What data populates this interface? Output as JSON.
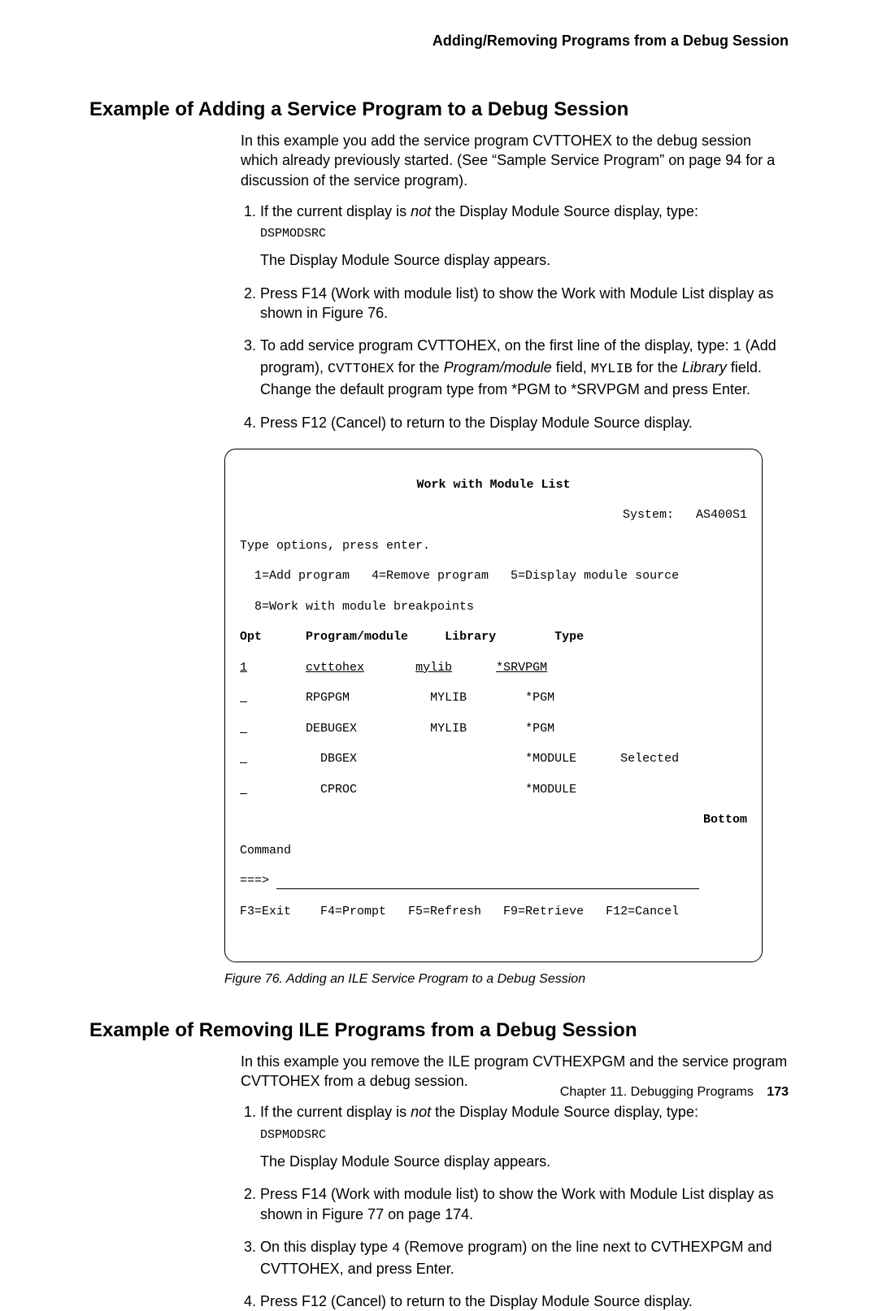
{
  "running_head": "Adding/Removing Programs from a Debug Session",
  "section1": {
    "title": "Example of Adding a Service Program to a Debug Session",
    "intro": "In this example you add the service program CVTTOHEX to the debug session which already previously started. (See “Sample Service Program” on page 94 for a discussion of the service program).",
    "step1a": "If the current display is ",
    "step1_not": "not",
    "step1b": " the Display Module Source display, type:",
    "step1_cmd": "DSPMODSRC",
    "step1_after": "The Display Module Source display appears.",
    "step2": "Press F14 (Work with module list) to show the Work with Module List display as shown in Figure 76.",
    "step3a": "To add service program CVTTOHEX, on the first line of the display, type: ",
    "step3_code1": "1",
    "step3b": " (Add program), ",
    "step3_code2": "CVTTOHEX",
    "step3c": " for the ",
    "step3_it1": "Program/module",
    "step3d": " field, ",
    "step3_code3": "MYLIB",
    "step3e": " for the ",
    "step3_it2": "Library",
    "step3f": " field. Change the default program type from *PGM to *SRVPGM and press Enter.",
    "step4": "Press F12 (Cancel) to return to the Display Module Source display."
  },
  "terminal": {
    "title": "Work with Module List",
    "system_label": "System:",
    "system_value": "AS400S1",
    "line1": "Type options, press enter.",
    "line2": "  1=Add program   4=Remove program   5=Display module source",
    "line3": "  8=Work with module breakpoints",
    "hdr_opt": "Opt",
    "hdr_pm": "Program/module",
    "hdr_lib": "Library",
    "hdr_type": "Type",
    "r1_opt": "1",
    "r1_pm": "cvttohex",
    "r1_lib": "mylib",
    "r1_type": "*SRVPGM",
    "r2_pm": "RPGPGM",
    "r2_lib": "MYLIB",
    "r2_type": "*PGM",
    "r3_pm": "DEBUGEX",
    "r3_lib": "MYLIB",
    "r3_type": "*PGM",
    "r4_pm": "DBGEX",
    "r4_type": "*MODULE",
    "r4_sel": "Selected",
    "r5_pm": "CPROC",
    "r5_type": "*MODULE",
    "bottom": "Bottom",
    "command": "Command",
    "prompt": "===>",
    "fkeys": "F3=Exit    F4=Prompt   F5=Refresh   F9=Retrieve   F12=Cancel"
  },
  "caption": "Figure 76. Adding an ILE Service Program to a Debug Session",
  "section2": {
    "title": "Example of Removing ILE Programs from a Debug Session",
    "intro": "In this example you remove the ILE program CVTHEXPGM and the service program CVTTOHEX from a debug session.",
    "step1a": "If the current display is ",
    "step1_not": "not",
    "step1b": " the Display Module Source display, type:",
    "step1_cmd": "DSPMODSRC",
    "step1_after": "The Display Module Source display appears.",
    "step2": "Press F14 (Work with module list) to show the Work with Module List display as shown in Figure 77 on page 174.",
    "step3a": "On this display type ",
    "step3_code": "4",
    "step3b": " (Remove program) on the line next to CVTHEXPGM and CVTTOHEX, and press Enter.",
    "step4": "Press F12 (Cancel) to return to the Display Module Source display."
  },
  "footer_chapter": "Chapter 11. Debugging Programs",
  "footer_page": "173"
}
